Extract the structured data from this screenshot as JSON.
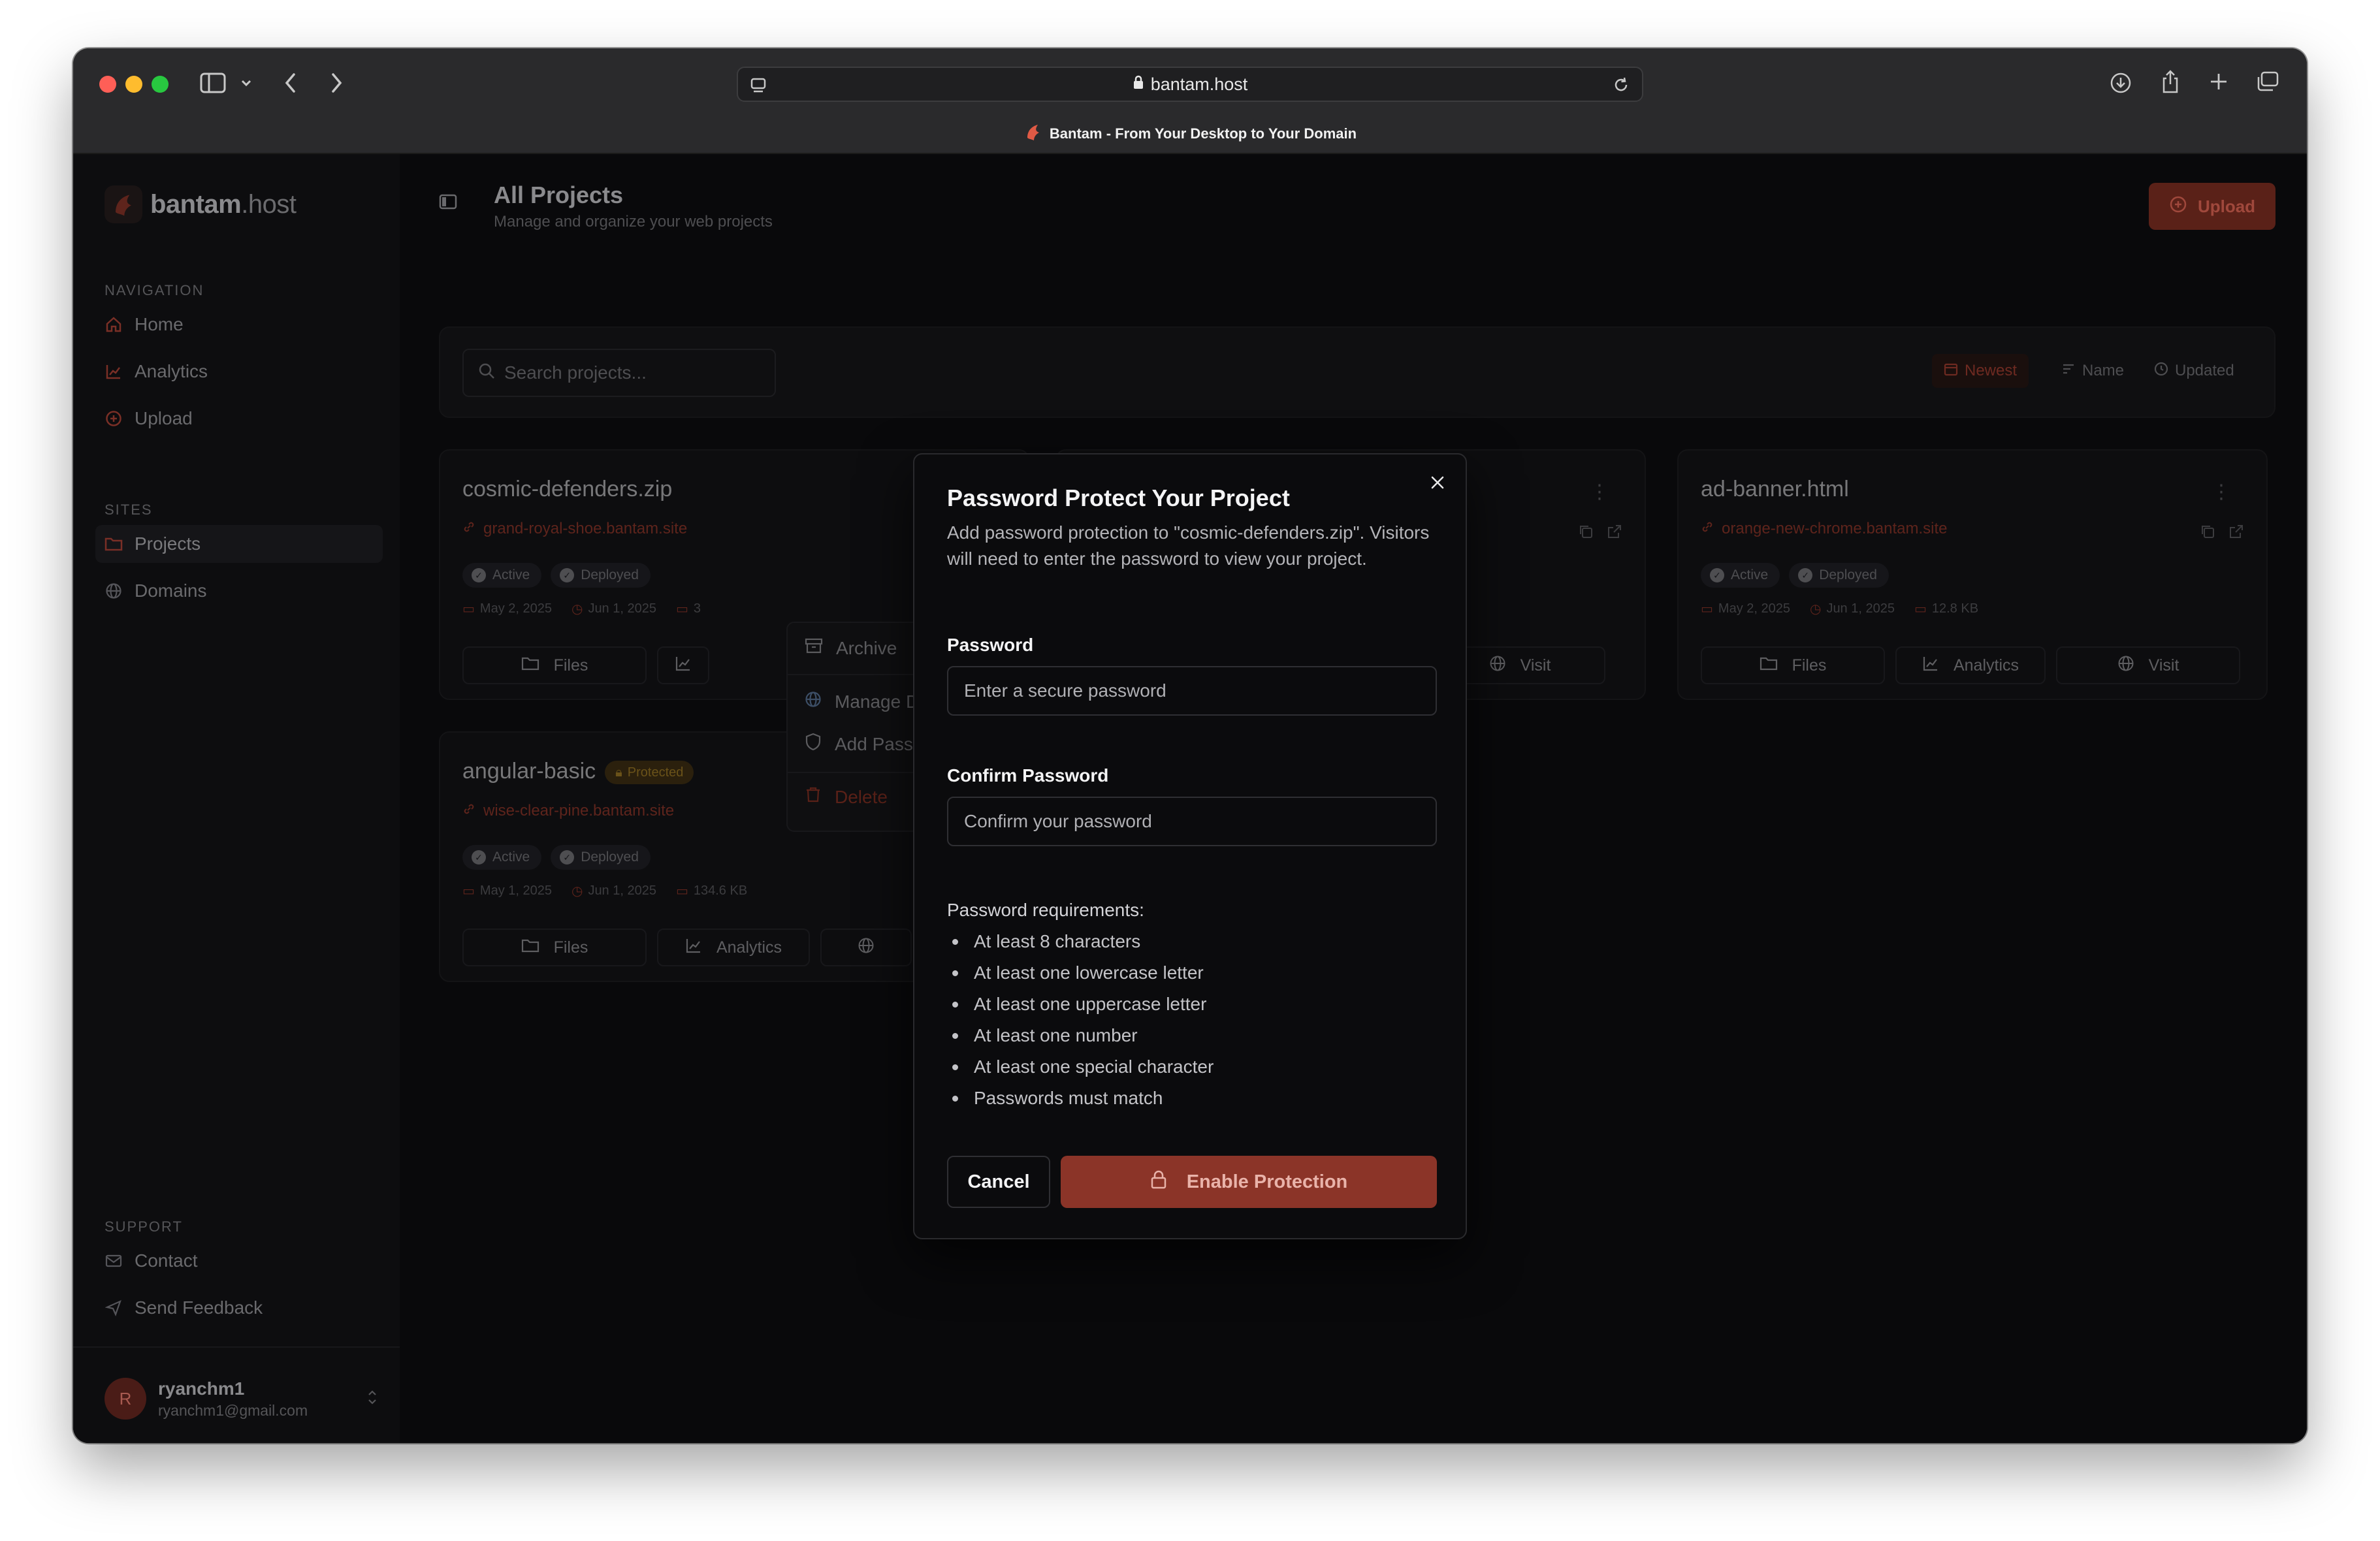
{
  "browser": {
    "url": "bantam.host",
    "tab_title": "Bantam - From Your Desktop to Your Domain"
  },
  "brand": {
    "name_bold": "bantam",
    "name_light": ".host"
  },
  "sidebar": {
    "navigation_title": "NAVIGATION",
    "navigation": [
      {
        "label": "Home",
        "icon": "home-icon"
      },
      {
        "label": "Analytics",
        "icon": "chart-icon"
      },
      {
        "label": "Upload",
        "icon": "plus-circle-icon"
      }
    ],
    "sites_title": "SITES",
    "sites": [
      {
        "label": "Projects",
        "icon": "folder-icon",
        "active": true
      },
      {
        "label": "Domains",
        "icon": "globe-icon"
      }
    ],
    "support_title": "SUPPORT",
    "support": [
      {
        "label": "Contact",
        "icon": "mail-icon"
      },
      {
        "label": "Send Feedback",
        "icon": "send-icon"
      }
    ],
    "user": {
      "initial": "R",
      "name": "ryanchm1",
      "email": "ryanchm1@gmail.com"
    }
  },
  "header": {
    "title": "All Projects",
    "subtitle": "Manage and organize your web projects",
    "upload_label": "Upload"
  },
  "toolbar": {
    "search_placeholder": "Search projects...",
    "sort": [
      {
        "label": "Newest",
        "active": true
      },
      {
        "label": "Name"
      },
      {
        "label": "Updated"
      }
    ]
  },
  "projects": [
    {
      "name": "cosmic-defenders.zip",
      "url": "grand-royal-shoe.bantam.site",
      "status": [
        "Active",
        "Deployed"
      ],
      "created": "May 2, 2025",
      "updated": "Jun 1, 2025",
      "size_partial": "3"
    },
    {
      "name": "ad-banner.html",
      "url": "orange-new-chrome.bantam.site",
      "status": [
        "Active",
        "Deployed"
      ],
      "created": "May 2, 2025",
      "updated": "Jun 1, 2025",
      "size": "12.8 KB"
    },
    {
      "name": "angular-basic",
      "protected_label": "Protected",
      "url": "wise-clear-pine.bantam.site",
      "status": [
        "Active",
        "Deployed"
      ],
      "created": "May 1, 2025",
      "updated": "Jun 1, 2025",
      "size": "134.6 KB"
    }
  ],
  "card_actions": {
    "files": "Files",
    "analytics": "Analytics",
    "visit": "Visit"
  },
  "context_menu": {
    "archive": "Archive",
    "manage_domains": "Manage Domains",
    "add_password": "Add Password",
    "delete": "Delete"
  },
  "modal": {
    "title": "Password Protect Your Project",
    "description": "Add password protection to \"cosmic-defenders.zip\". Visitors will need to enter the password to view your project.",
    "password_label": "Password",
    "password_placeholder": "Enter a secure password",
    "confirm_label": "Confirm Password",
    "confirm_placeholder": "Confirm your password",
    "requirements_title": "Password requirements:",
    "requirements": [
      "At least 8 characters",
      "At least one lowercase letter",
      "At least one uppercase letter",
      "At least one number",
      "At least one special character",
      "Passwords must match"
    ],
    "cancel_label": "Cancel",
    "enable_label": "Enable Protection"
  },
  "colors": {
    "accent": "#8b3428",
    "background": "#09090b",
    "modal_bg": "#0b0b0d"
  }
}
